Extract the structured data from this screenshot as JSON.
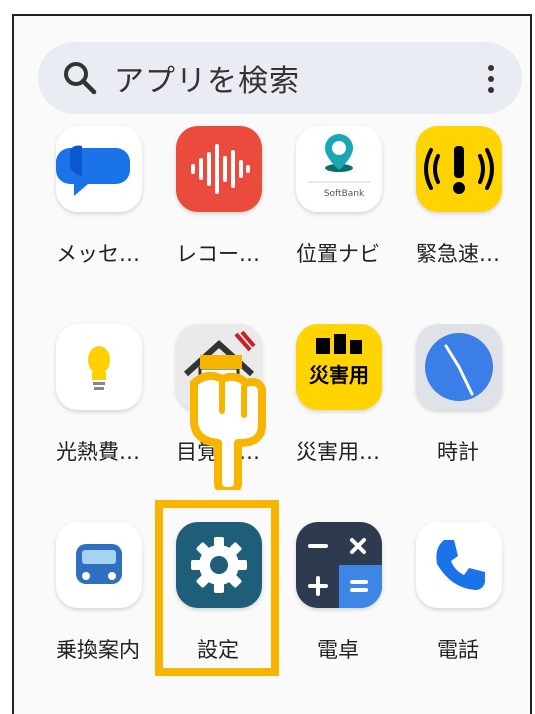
{
  "search": {
    "placeholder": "アプリを検索"
  },
  "apps": [
    {
      "id": "messages",
      "label": "メッセ…",
      "icon": "messages-icon"
    },
    {
      "id": "recorder",
      "label": "レコー…",
      "icon": "recorder-icon"
    },
    {
      "id": "location-navi",
      "label": "位置ナビ",
      "icon": "location-navi-icon",
      "icon_text": "SoftBank"
    },
    {
      "id": "emergency-alert",
      "label": "緊急速…",
      "icon": "emergency-alert-icon"
    },
    {
      "id": "utility-cost",
      "label": "光熱費…",
      "icon": "lightbulb-icon"
    },
    {
      "id": "home-app",
      "label": "目覚し…",
      "icon": "house-icon"
    },
    {
      "id": "disaster-app",
      "label": "災害用…",
      "icon": "disaster-app-icon",
      "icon_text": "災害用"
    },
    {
      "id": "clock",
      "label": "時計",
      "icon": "clock-icon"
    },
    {
      "id": "transit",
      "label": "乗換案内",
      "icon": "transit-icon"
    },
    {
      "id": "settings",
      "label": "設定",
      "icon": "gear-icon"
    },
    {
      "id": "calculator",
      "label": "電卓",
      "icon": "calculator-icon"
    },
    {
      "id": "phone",
      "label": "電話",
      "icon": "phone-icon"
    }
  ],
  "colors": {
    "highlight": "#f7b500",
    "settings_tile": "#1f5e78"
  }
}
